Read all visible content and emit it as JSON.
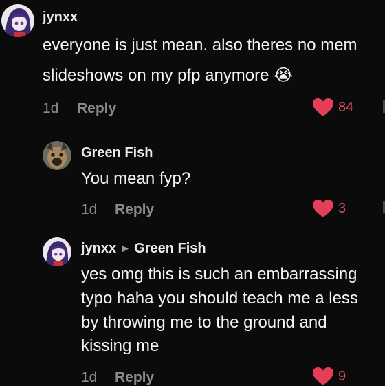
{
  "comments": [
    {
      "username": "jynxx",
      "text_line1": "everyone is just mean. also theres no mem",
      "text_line2": "slideshows on my pfp anymore",
      "emoji": "😭",
      "age": "1d",
      "reply_label": "Reply",
      "likes": "84"
    },
    {
      "username": "Green Fish",
      "text_line1": "You mean fyp?",
      "age": "1d",
      "reply_label": "Reply",
      "likes": "3"
    },
    {
      "username": "jynxx",
      "reply_to": "Green Fish",
      "text_line1": "yes omg this is such an embarrassing",
      "text_line2": "typo haha you should teach me a less",
      "text_line3": "by throwing me to the ground and",
      "text_line4": "kissing me",
      "age": "1d",
      "reply_label": "Reply",
      "likes": "9"
    }
  ],
  "colors": {
    "background": "#0b0b0b",
    "like_heart": "#e53e58",
    "muted_text": "#8a8a8a"
  },
  "icons": {
    "like": "heart-icon",
    "reply_arrow": "play-triangle-icon"
  }
}
